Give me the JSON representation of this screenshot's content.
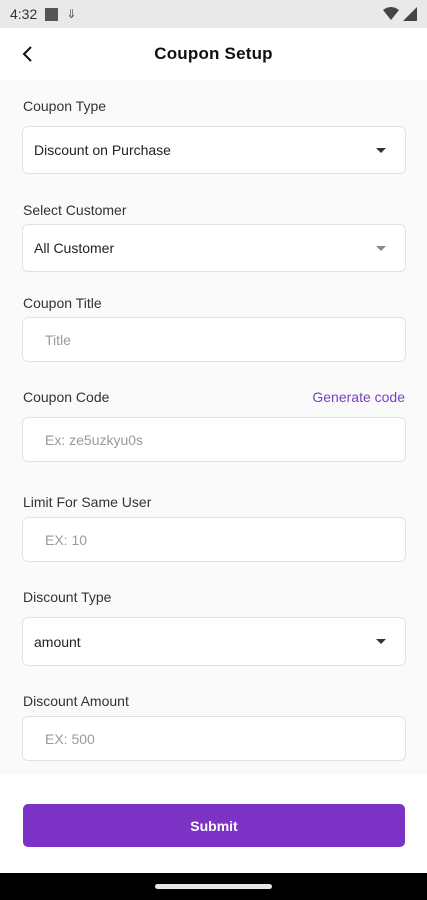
{
  "status_bar": {
    "time": "4:32"
  },
  "header": {
    "title": "Coupon Setup"
  },
  "form": {
    "coupon_type": {
      "label": "Coupon Type",
      "value": "Discount on Purchase"
    },
    "select_customer": {
      "label": "Select Customer",
      "value": "All Customer"
    },
    "coupon_title": {
      "label": "Coupon Title",
      "placeholder": "Title"
    },
    "coupon_code": {
      "label": "Coupon Code",
      "link": "Generate code",
      "placeholder": "Ex: ze5uzkyu0s"
    },
    "limit_same_user": {
      "label": "Limit For Same User",
      "placeholder": "EX: 10"
    },
    "discount_type": {
      "label": "Discount Type",
      "value": "amount"
    },
    "discount_amount": {
      "label": "Discount Amount",
      "placeholder": "EX: 500"
    }
  },
  "submit": {
    "label": "Submit"
  },
  "colors": {
    "accent": "#7c32c4"
  }
}
